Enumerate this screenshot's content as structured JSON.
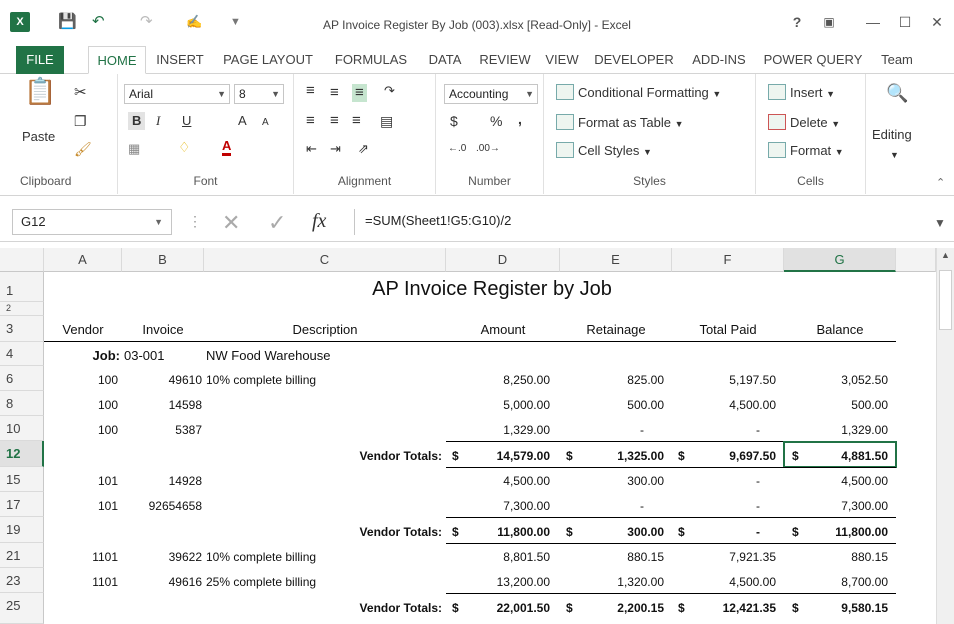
{
  "window": {
    "title": "AP Invoice Register By Job (003).xlsx  [Read-Only] - Excel",
    "app_icon": "X",
    "help": "?",
    "accent": "#217346"
  },
  "tabs": [
    "FILE",
    "HOME",
    "INSERT",
    "PAGE LAYOUT",
    "FORMULAS",
    "DATA",
    "REVIEW",
    "VIEW",
    "DEVELOPER",
    "ADD-INS",
    "POWER QUERY",
    "Team"
  ],
  "ribbon": {
    "clipboard": {
      "paste": "Paste",
      "label": "Clipboard"
    },
    "font": {
      "name": "Arial",
      "size": "8",
      "bold": "B",
      "italic": "I",
      "underline": "U",
      "grow": "A",
      "shrink": "A",
      "color": "A",
      "label": "Font"
    },
    "alignment": {
      "label": "Alignment"
    },
    "number": {
      "format": "Accounting",
      "dollar": "$",
      "percent": "%",
      "comma": ",",
      "label": "Number"
    },
    "styles": {
      "conditional": "Conditional Formatting",
      "table": "Format as Table",
      "cell": "Cell Styles",
      "label": "Styles"
    },
    "cells": {
      "insert": "Insert",
      "delete": "Delete",
      "format": "Format",
      "label": "Cells"
    },
    "editing": {
      "label": "Editing"
    }
  },
  "formula_bar": {
    "name_box": "G12",
    "fx": "fx",
    "formula": "=SUM(Sheet1!G5:G10)/2"
  },
  "columns": [
    "A",
    "B",
    "C",
    "D",
    "E",
    "F",
    "G"
  ],
  "rows": [
    "1",
    "2",
    "3",
    "4",
    "6",
    "8",
    "10",
    "12",
    "15",
    "17",
    "19",
    "21",
    "23",
    "25"
  ],
  "sheet": {
    "title": "AP Invoice Register by Job",
    "headers": [
      "Vendor",
      "Invoice",
      "Description",
      "Amount",
      "Retainage",
      "Total Paid",
      "Balance"
    ],
    "job_label": "Job:",
    "job_number": "03-001",
    "job_name": "NW Food Warehouse",
    "lines": [
      {
        "vendor": "100",
        "invoice": "49610",
        "desc": "10% complete billing",
        "amount": "8,250.00",
        "ret": "825.00",
        "paid": "5,197.50",
        "bal": "3,052.50"
      },
      {
        "vendor": "100",
        "invoice": "14598",
        "desc": "",
        "amount": "5,000.00",
        "ret": "500.00",
        "paid": "4,500.00",
        "bal": "500.00"
      },
      {
        "vendor": "100",
        "invoice": "5387",
        "desc": "",
        "amount": "1,329.00",
        "ret": "-",
        "paid": "-",
        "bal": "1,329.00"
      },
      {
        "total": true,
        "label": "Vendor Totals:",
        "amount": "14,579.00",
        "ret": "1,325.00",
        "paid": "9,697.50",
        "bal": "4,881.50"
      },
      {
        "vendor": "101",
        "invoice": "14928",
        "desc": "",
        "amount": "4,500.00",
        "ret": "300.00",
        "paid": "-",
        "bal": "4,500.00"
      },
      {
        "vendor": "101",
        "invoice": "92654658",
        "desc": "",
        "amount": "7,300.00",
        "ret": "-",
        "paid": "-",
        "bal": "7,300.00"
      },
      {
        "total": true,
        "label": "Vendor Totals:",
        "amount": "11,800.00",
        "ret": "300.00",
        "paid": "-",
        "bal": "11,800.00"
      },
      {
        "vendor": "1101",
        "invoice": "39622",
        "desc": "10% complete billing",
        "amount": "8,801.50",
        "ret": "880.15",
        "paid": "7,921.35",
        "bal": "880.15"
      },
      {
        "vendor": "1101",
        "invoice": "49616",
        "desc": "25% complete billing",
        "amount": "13,200.00",
        "ret": "1,320.00",
        "paid": "4,500.00",
        "bal": "8,700.00"
      },
      {
        "total": true,
        "label": "Vendor Totals:",
        "amount": "22,001.50",
        "ret": "2,200.15",
        "paid": "12,421.35",
        "bal": "9,580.15"
      }
    ],
    "currency": "$"
  }
}
